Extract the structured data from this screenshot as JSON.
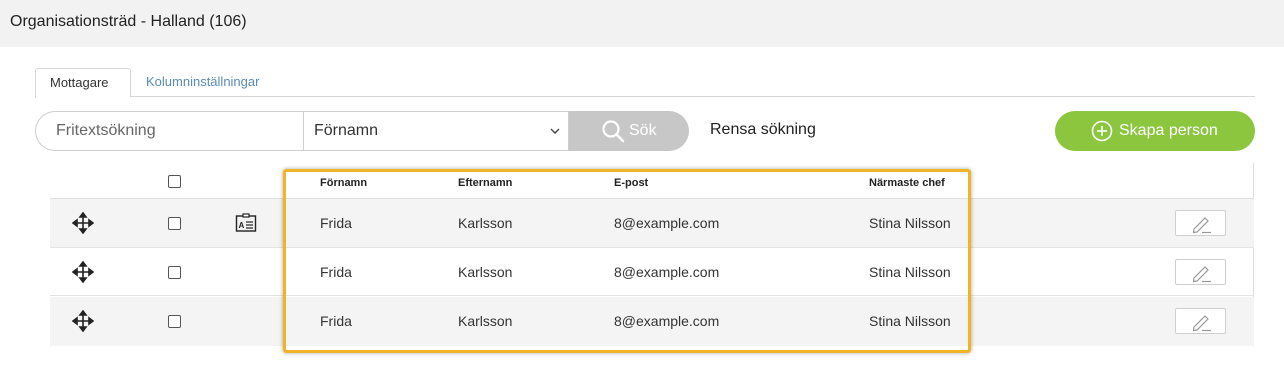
{
  "header": {
    "title": "Organisationsträd - Halland (106)"
  },
  "tabs": [
    {
      "label": "Mottagare",
      "active": true
    },
    {
      "label": "Kolumninställningar",
      "active": false
    }
  ],
  "search": {
    "placeholder": "Fritextsökning",
    "field_selected": "Förnamn",
    "search_label": "Sök",
    "clear_label": "Rensa sökning"
  },
  "actions": {
    "create_label": "Skapa person"
  },
  "table": {
    "columns": [
      "Förnamn",
      "Efternamn",
      "E-post",
      "Närmaste chef"
    ],
    "rows": [
      {
        "first": "Frida",
        "last": "Karlsson",
        "email": "8@example.com",
        "manager": "Stina Nilsson",
        "has_card": true
      },
      {
        "first": "Frida",
        "last": "Karlsson",
        "email": "8@example.com",
        "manager": "Stina Nilsson",
        "has_card": false
      },
      {
        "first": "Frida",
        "last": "Karlsson",
        "email": "8@example.com",
        "manager": "Stina Nilsson",
        "has_card": false
      }
    ]
  },
  "icons": {
    "search": "magnifier-icon",
    "create": "plus-circle-icon",
    "move": "move-arrows-icon",
    "card": "contact-card-icon",
    "edit": "pencil-icon",
    "chevron": "chevron-down-icon"
  },
  "colors": {
    "accent_green": "#8cc63f",
    "search_button": "#c7c7c7",
    "tab_inactive": "#5a8bb0",
    "highlight": "#f0b429",
    "header_bg": "#f2f2f2"
  }
}
